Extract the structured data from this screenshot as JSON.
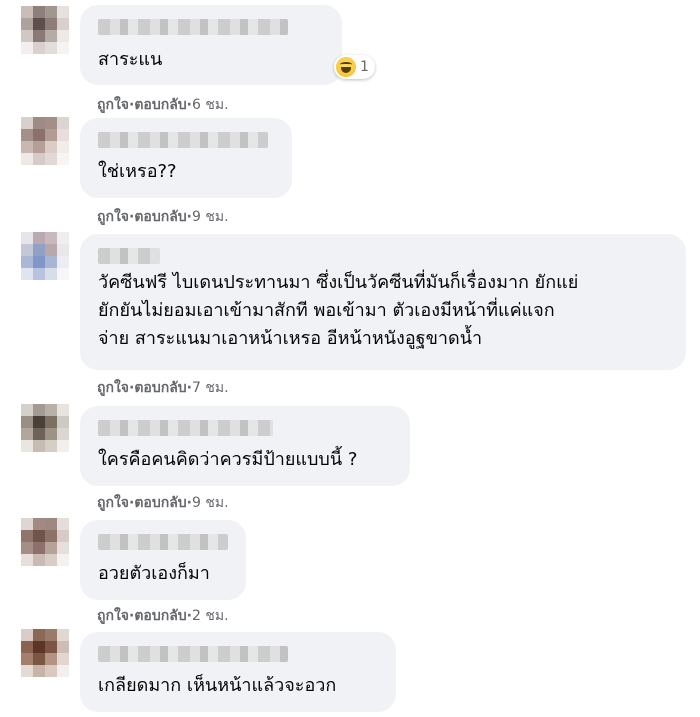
{
  "actions": {
    "like": "ถูกใจ",
    "reply": "ตอบกลับ",
    "sep": " · "
  },
  "comments": [
    {
      "text": "สาระแน",
      "time": "6 ชม.",
      "reaction": {
        "icon": "haha-reaction-icon",
        "count": "1"
      }
    },
    {
      "text": "ใช่เหรอ??",
      "time": "9 ชม."
    },
    {
      "text": "วัคซีนฟรี ไบเดนประทานมา ซึ่งเป็นวัคซีนที่มันก็เรื่องมาก ยักแย่\nยักยันไม่ยอมเอาเข้ามาสักที พอเข้ามา ตัวเองมีหน้าที่แค่แจก\nจ่าย สาระแนมาเอาหน้าเหรอ อีหน้าหนังอูฐขาดน้ำ",
      "time": "7 ชม."
    },
    {
      "text": "ใครคือคนคิดว่าควรมีป้ายแบบนี้ ?",
      "time": "9 ชม."
    },
    {
      "text": "อวยตัวเองก็มา",
      "time": "2 ชม."
    },
    {
      "text": "เกลียดมาก เห็นหน้าแล้วจะอวก"
    }
  ],
  "colors": {
    "bubble": "#f0f2f5",
    "meta": "#65676b",
    "text": "#050505"
  }
}
